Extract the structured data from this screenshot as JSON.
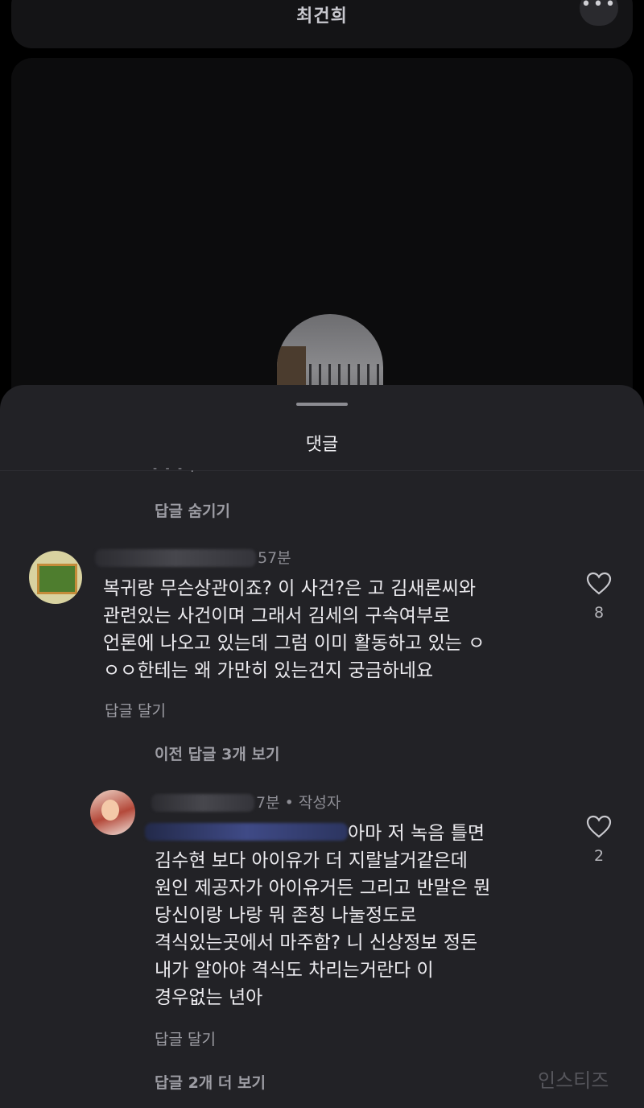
{
  "header": {
    "title": "최건희",
    "more_label": "•••"
  },
  "sheet": {
    "title": "댓글",
    "collapsed_snippet": "- - - .",
    "hide_replies": "답글 숨기기",
    "view_previous": "이전 답글 3개 보기",
    "view_more": "답글 2개 더 보기"
  },
  "comments": [
    {
      "time": "57분",
      "lines": [
        "복귀랑 무슨상관이죠? 이 사건?은 고 김새론씨와",
        "관련있는 사건이며 그래서 김세의 구속여부로",
        "언론에 나오고 있는데 그럼 이미 활동하고 있는 ㅇ",
        "ㅇㅇ한테는 왜 가만히 있는건지 궁금하네요"
      ],
      "reply_label": "답글 달기",
      "likes": "8"
    },
    {
      "time": "7분 • 작성자",
      "lines": [
        "아마 저 녹음 틀면",
        "김수현 보다 아이유가 더 지랄날거같은데",
        "원인 제공자가 아이유거든 그리고 반말은 뭔",
        "당신이랑 나랑 뭐 존칭 나눌정도로",
        "격식있는곳에서 마주함? 니 신상정보 정돈",
        "내가 알아야 격식도 차리는거란다 이",
        "경우없는 년아"
      ],
      "reply_label": "답글 달기",
      "likes": "2"
    }
  ],
  "watermark": "인스티즈",
  "colors": {
    "sheet_bg": "#222226",
    "page_bg": "#000000",
    "muted_text": "#9d9da4"
  }
}
